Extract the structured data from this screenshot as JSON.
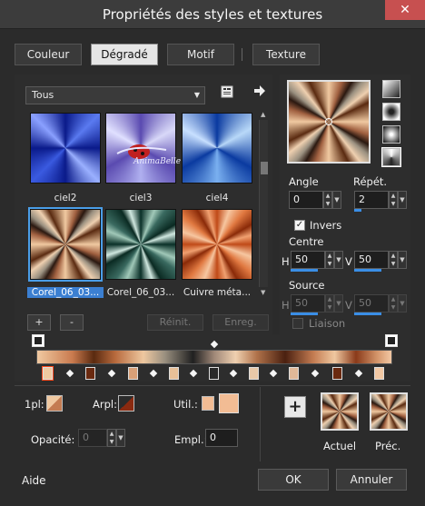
{
  "window": {
    "title": "Propriétés des styles et textures",
    "close_label": "✕"
  },
  "tabs": [
    {
      "label": "Couleur"
    },
    {
      "label": "Dégradé"
    },
    {
      "label": "Motif"
    },
    {
      "label": "Texture"
    }
  ],
  "library": {
    "dropdown_value": "Tous",
    "items": [
      {
        "name": "ciel2"
      },
      {
        "name": "ciel3",
        "watermark": "AnimaBelle"
      },
      {
        "name": "ciel4"
      },
      {
        "name": "Corel_06_03..."
      },
      {
        "name": "Corel_06_03..."
      },
      {
        "name": "Cuivre méta..."
      }
    ],
    "add_label": "+",
    "remove_label": "-",
    "reset_label": "Réinit.",
    "save_label": "Enreg."
  },
  "settings": {
    "angle_label": "Angle",
    "angle_value": "0",
    "repeat_label": "Répét.",
    "repeat_value": "2",
    "invert_label": "Invers",
    "invert_checked": true,
    "center_label": "Centre",
    "center_h_label": "H",
    "center_h_value": "50",
    "center_v_label": "V",
    "center_v_value": "50",
    "source_label": "Source",
    "source_h_label": "H",
    "source_h_value": "50",
    "source_v_label": "V",
    "source_v_value": "50",
    "link_label": "Liaison"
  },
  "gradient_editor": {
    "fg_label": "1pl:",
    "bg_label": "Arpl:",
    "user_label": "Util.:",
    "opacity_label": "Opacité:",
    "opacity_value": "0",
    "location_label": "Empl.:",
    "location_value": "0"
  },
  "swatches": {
    "add_label": "+",
    "current_label": "Actuel",
    "previous_label": "Préc."
  },
  "footer": {
    "help_label": "Aide",
    "ok_label": "OK",
    "cancel_label": "Annuler"
  },
  "colors": {
    "accent": "#3a8ee6",
    "copper_light": "#f0c9a1",
    "copper_dark": "#5a2a10",
    "user_color": "#f2bc94"
  }
}
